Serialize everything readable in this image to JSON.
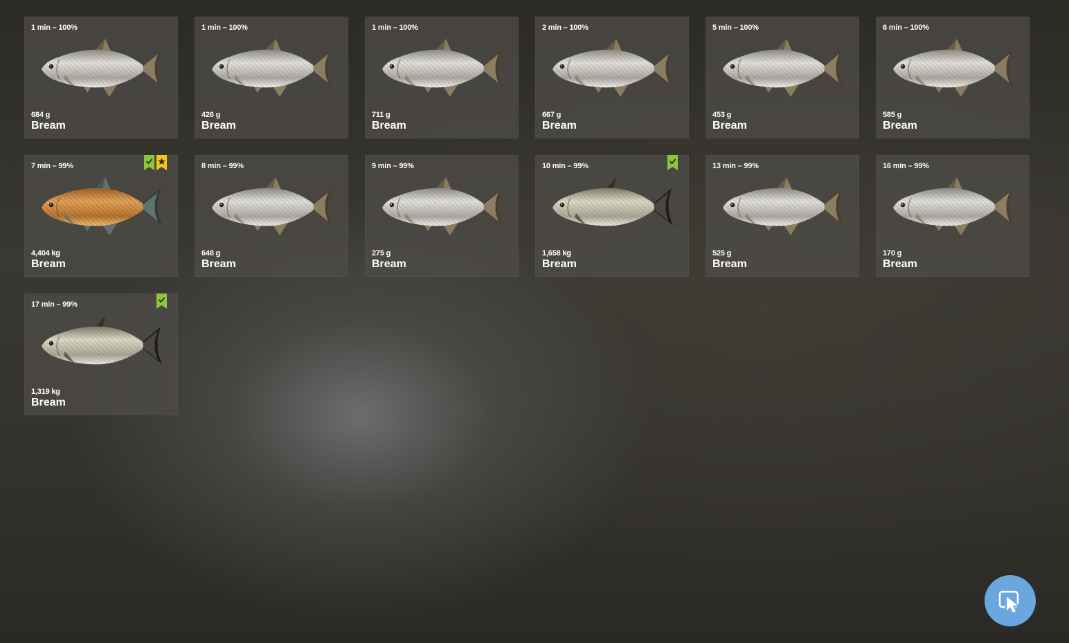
{
  "cards": [
    {
      "time": "1 min",
      "pct": "100%",
      "weight": "684 g",
      "name": "Bream",
      "variant": "silver",
      "badges": []
    },
    {
      "time": "1 min",
      "pct": "100%",
      "weight": "426 g",
      "name": "Bream",
      "variant": "silver",
      "badges": []
    },
    {
      "time": "1 min",
      "pct": "100%",
      "weight": "711 g",
      "name": "Bream",
      "variant": "silver",
      "badges": []
    },
    {
      "time": "2 min",
      "pct": "100%",
      "weight": "667 g",
      "name": "Bream",
      "variant": "silver",
      "badges": []
    },
    {
      "time": "5 min",
      "pct": "100%",
      "weight": "453 g",
      "name": "Bream",
      "variant": "silver",
      "badges": []
    },
    {
      "time": "6 min",
      "pct": "100%",
      "weight": "585 g",
      "name": "Bream",
      "variant": "silver",
      "badges": []
    },
    {
      "time": "7 min",
      "pct": "99%",
      "weight": "4,404 kg",
      "name": "Bream",
      "variant": "gold",
      "badges": [
        "check",
        "star"
      ]
    },
    {
      "time": "8 min",
      "pct": "99%",
      "weight": "648 g",
      "name": "Bream",
      "variant": "silver",
      "badges": []
    },
    {
      "time": "9 min",
      "pct": "99%",
      "weight": "275 g",
      "name": "Bream",
      "variant": "silver",
      "badges": []
    },
    {
      "time": "10 min",
      "pct": "99%",
      "weight": "1,658 kg",
      "name": "Bream",
      "variant": "bronze",
      "badges": [
        "check"
      ]
    },
    {
      "time": "13 min",
      "pct": "99%",
      "weight": "525 g",
      "name": "Bream",
      "variant": "silver",
      "badges": []
    },
    {
      "time": "16 min",
      "pct": "99%",
      "weight": "170 g",
      "name": "Bream",
      "variant": "silver",
      "badges": []
    },
    {
      "time": "17 min",
      "pct": "99%",
      "weight": "1,319 kg",
      "name": "Bream",
      "variant": "bronze",
      "badges": [
        "check"
      ]
    }
  ],
  "separator": " – ",
  "colors": {
    "badge_check": "#8cc63f",
    "badge_star": "#f5c518",
    "cursor_button": "#6aa7de"
  },
  "icons": {
    "cursor_button": "cursor-select-icon",
    "badge_check": "bookmark-check-icon",
    "badge_star": "bookmark-star-icon",
    "fish": "bream-fish-icon"
  }
}
